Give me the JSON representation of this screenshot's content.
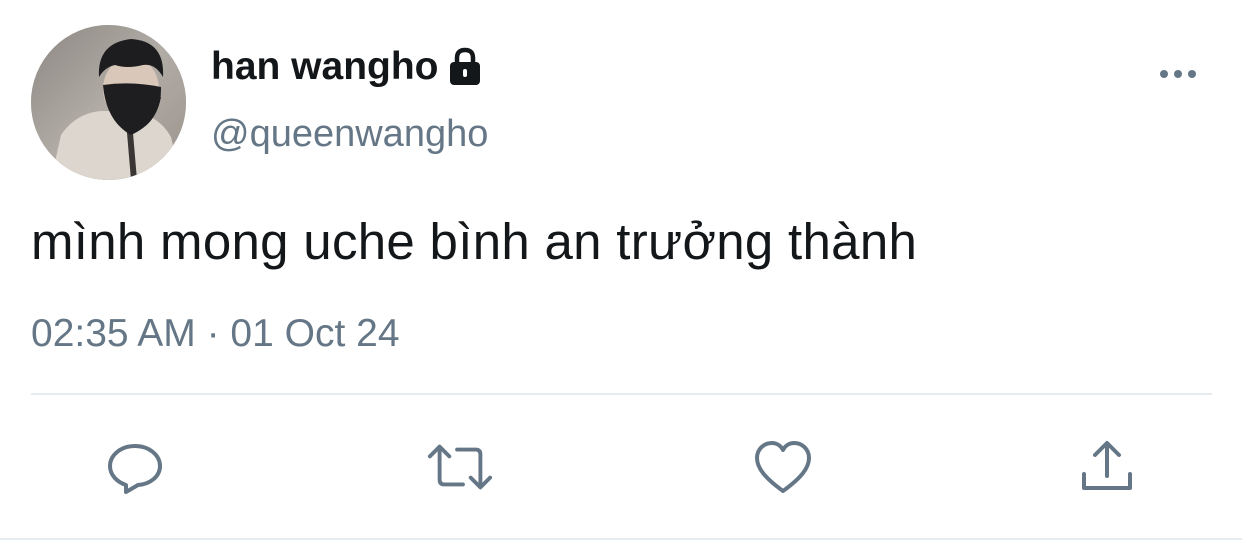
{
  "user": {
    "display_name": "han wangho",
    "handle": "@queenwangho",
    "protected_icon": "lock-icon",
    "avatar": "profile-photo"
  },
  "tweet": {
    "text": "mình mong uche bình an trưởng thành",
    "timestamp": "02:35 AM · 01 Oct 24"
  },
  "actions": {
    "more": "more-options-icon",
    "reply": "reply-icon",
    "retweet": "retweet-icon",
    "like": "heart-icon",
    "share": "share-icon"
  },
  "colors": {
    "primary_text": "#14171a",
    "secondary_text": "#657786",
    "icon": "#657786",
    "divider": "#e6ecf0"
  }
}
